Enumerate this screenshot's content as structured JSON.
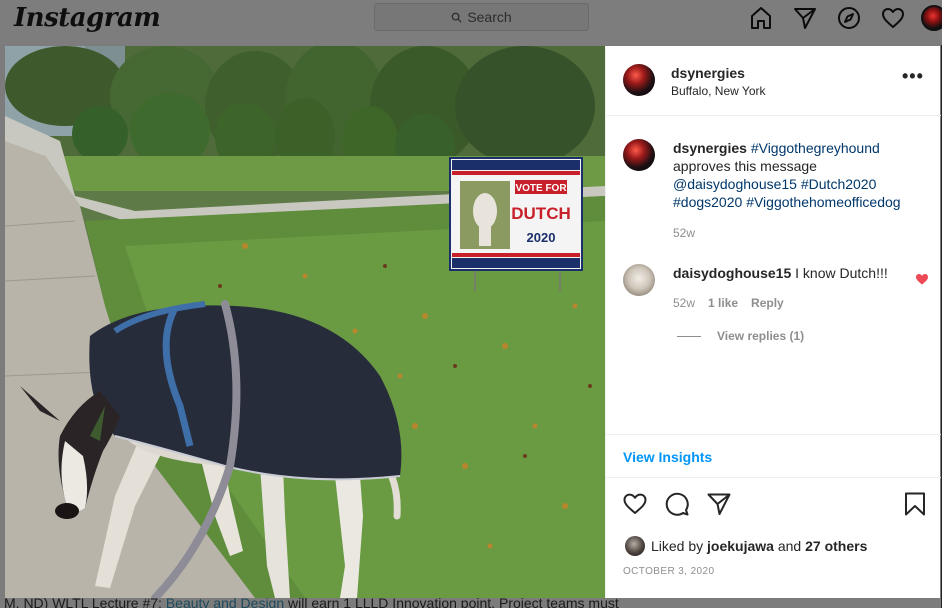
{
  "app": {
    "logo_text": "Instagram"
  },
  "search": {
    "placeholder": "Search"
  },
  "nav_icons": [
    "home-icon",
    "direct-icon",
    "explore-icon",
    "activity-heart-icon",
    "profile-avatar"
  ],
  "post": {
    "author": "dsynergies",
    "location": "Buffalo, New York",
    "photo": {
      "description": "Greyhound in navy coat and blue harness on a sidewalk next to a lawn sign",
      "sign_lines": [
        "VOTE FOR",
        "DUTCH",
        "2020"
      ]
    },
    "caption": {
      "username": "dsynergies",
      "parts": [
        {
          "text": "#Viggothegreyhound",
          "type": "tag"
        },
        {
          "text": " approves this message ",
          "type": "text"
        },
        {
          "text": "@daisydoghouse15",
          "type": "tag"
        },
        {
          "text": " ",
          "type": "text"
        },
        {
          "text": "#Dutch2020",
          "type": "tag"
        },
        {
          "text": " ",
          "type": "text"
        },
        {
          "text": "#dogs2020",
          "type": "tag"
        },
        {
          "text": " ",
          "type": "text"
        },
        {
          "text": "#Viggothehomeofficedog",
          "type": "tag"
        }
      ],
      "time": "52w"
    },
    "comments": [
      {
        "username": "daisydoghouse15",
        "text": " I know Dutch!!!",
        "time": "52w",
        "likes": "1 like",
        "reply_label": "Reply",
        "view_replies": "View replies (1)",
        "liked": true
      }
    ],
    "view_insights": "View Insights",
    "liked_by_prefix": "Liked by ",
    "liked_by_user": "joekujawa",
    "liked_by_and": " and ",
    "liked_by_others": "27 others",
    "date": "OCTOBER 3, 2020"
  },
  "background_page": {
    "text_before": "M, ND) WLTL Lecture #7: ",
    "link": "Beauty and Design",
    "text_after": " will earn 1 LLLD Innovation point. Project teams must"
  },
  "colors": {
    "accent": "#0095f6",
    "tag": "#00376b",
    "heart": "#ed4956",
    "overlay": "#7c7c7c"
  }
}
